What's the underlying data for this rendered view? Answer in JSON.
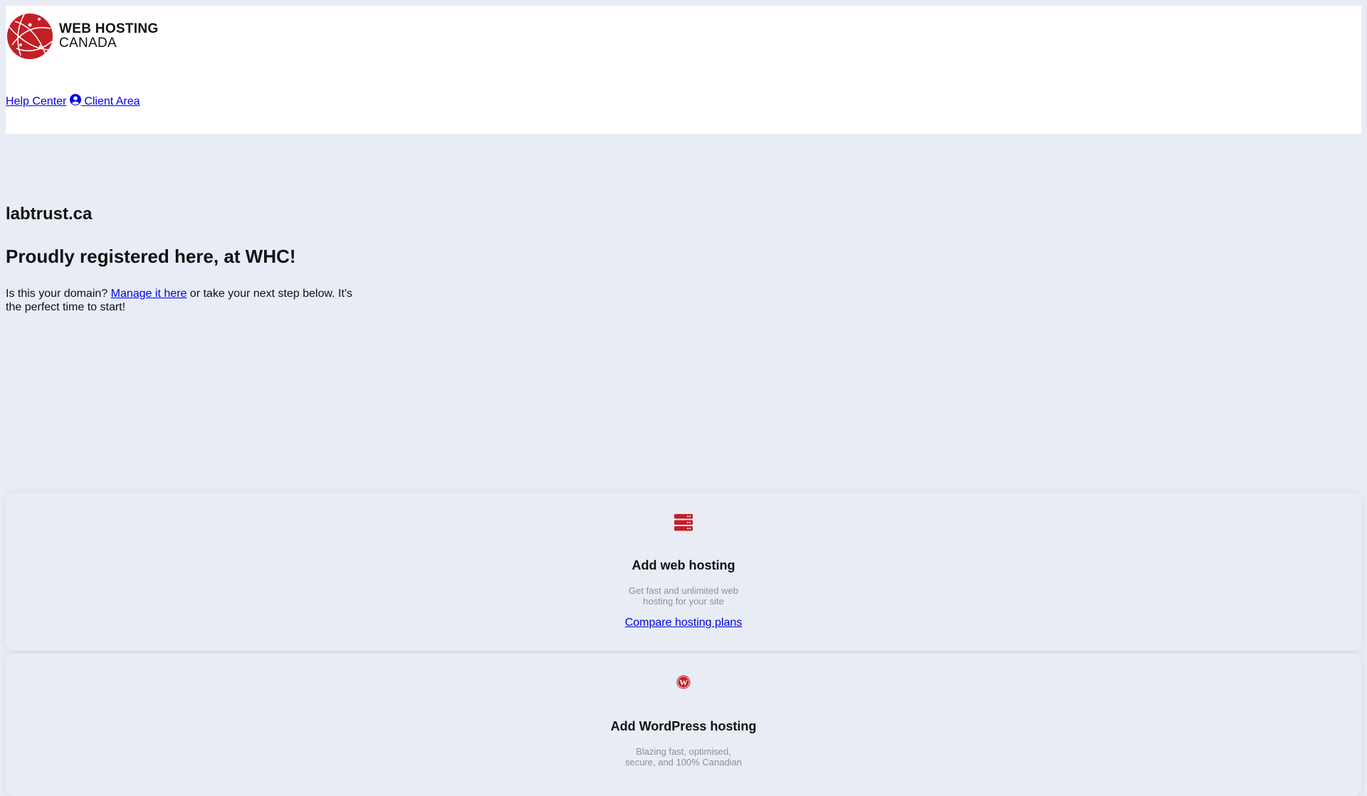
{
  "header": {
    "logo": {
      "line1": "WEB HOSTING",
      "line2": "CANADA"
    },
    "nav": {
      "help_center": "Help Center",
      "client_area": "Client Area"
    }
  },
  "main": {
    "domain": "labtrust.ca",
    "tagline": "Proudly registered here, at WHC!",
    "intro_before": "Is this your domain? ",
    "intro_link": "Manage it here",
    "intro_after": " or take your next step below. It's the perfect time to start!"
  },
  "cards": [
    {
      "icon": "server-icon",
      "title": "Add web hosting",
      "desc": "Get fast and unlimited web hosting for your site",
      "link": "Compare hosting plans"
    },
    {
      "icon": "wordpress-icon",
      "title": "Add WordPress hosting",
      "desc": "Blazing fast, optimised, secure, and 100% Canadian"
    }
  ],
  "colors": {
    "brand": "#c41e26",
    "background": "#e8ecf5",
    "link": "#0000ee"
  }
}
